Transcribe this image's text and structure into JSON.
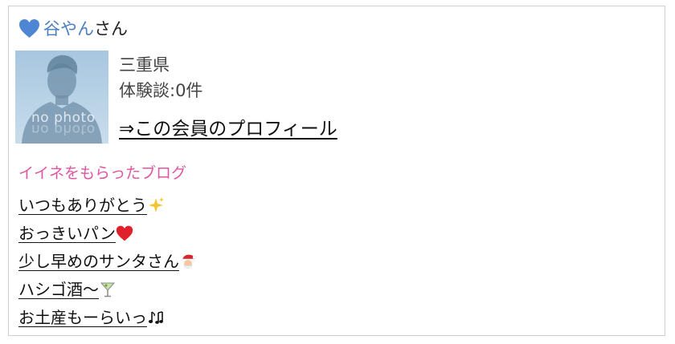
{
  "member": {
    "name": "谷やん",
    "suffix": "さん",
    "prefecture": "三重県",
    "experience": "体験談:0件",
    "profile_link": "⇒この会員のプロフィール",
    "photo_placeholder": "no photo"
  },
  "likes": {
    "title": "イイネをもらったブログ",
    "posts": [
      {
        "title": "いつもありがとう",
        "emoji": "sparkles-icon"
      },
      {
        "title": "おっきいパン",
        "emoji": "red-heart-icon"
      },
      {
        "title": "少し早めのサンタさん",
        "emoji": "santa-icon"
      },
      {
        "title": "ハシゴ酒〜",
        "emoji": "cocktail-icon"
      },
      {
        "title": "お土産もーらいっ",
        "emoji": "music-notes-icon"
      }
    ]
  },
  "colors": {
    "name_blue": "#4a7fc1",
    "section_pink": "#e0559f",
    "heart_blue": "#4f86d4"
  }
}
